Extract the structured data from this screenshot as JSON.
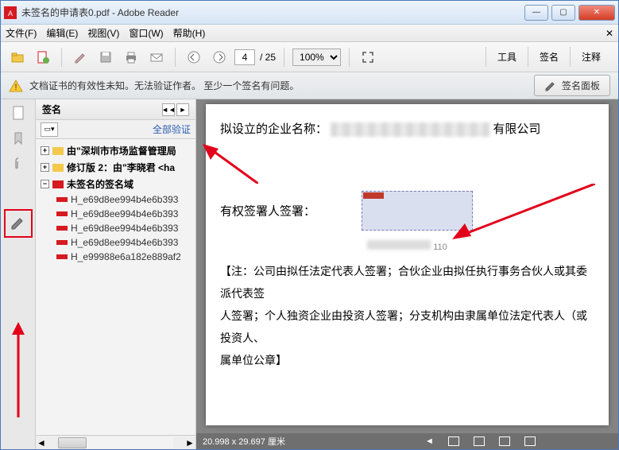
{
  "window": {
    "title": "未签名的申请表0.pdf - Adobe Reader"
  },
  "menubar": {
    "file": "文件(F)",
    "edit": "编辑(E)",
    "view": "视图(V)",
    "window": "窗口(W)",
    "help": "帮助(H)"
  },
  "toolbar": {
    "page_current": "4",
    "page_total": "/ 25",
    "zoom": "100%",
    "right": {
      "tools": "工具",
      "sign": "签名",
      "comment": "注释"
    }
  },
  "warning": {
    "text": "文档证书的有效性未知。无法验证作者。 至少一个签名有问题。",
    "panel_label": "签名面板"
  },
  "sidepanel": {
    "title": "签名",
    "verify_all": "全部验证",
    "items": [
      "由\"深圳市市场监督管理局",
      "修订版 2：由\"李晓君 <ha",
      "未签名的签名域"
    ],
    "fields": [
      "H_e69d8ee994b4e6b393",
      "H_e69d8ee994b4e6b393",
      "H_e69d8ee994b4e6b393",
      "H_e69d8ee994b4e6b393",
      "H_e99988e6a182e889af2"
    ]
  },
  "document": {
    "line1_prefix": "拟设立的企业名称：",
    "line1_suffix": "有限公司",
    "line2": "有权签署人签署：",
    "blur_code": "44050013            110",
    "note1": "【注：公司由拟任法定代表人签署；合伙企业由拟任执行事务合伙人或其委派代表签",
    "note2": "人签署；个人独资企业由投资人签署；分支机构由隶属单位法定代表人（或投资人、",
    "note3": "属单位公章】"
  },
  "status": {
    "dims": "20.998 x 29.697 厘米"
  }
}
